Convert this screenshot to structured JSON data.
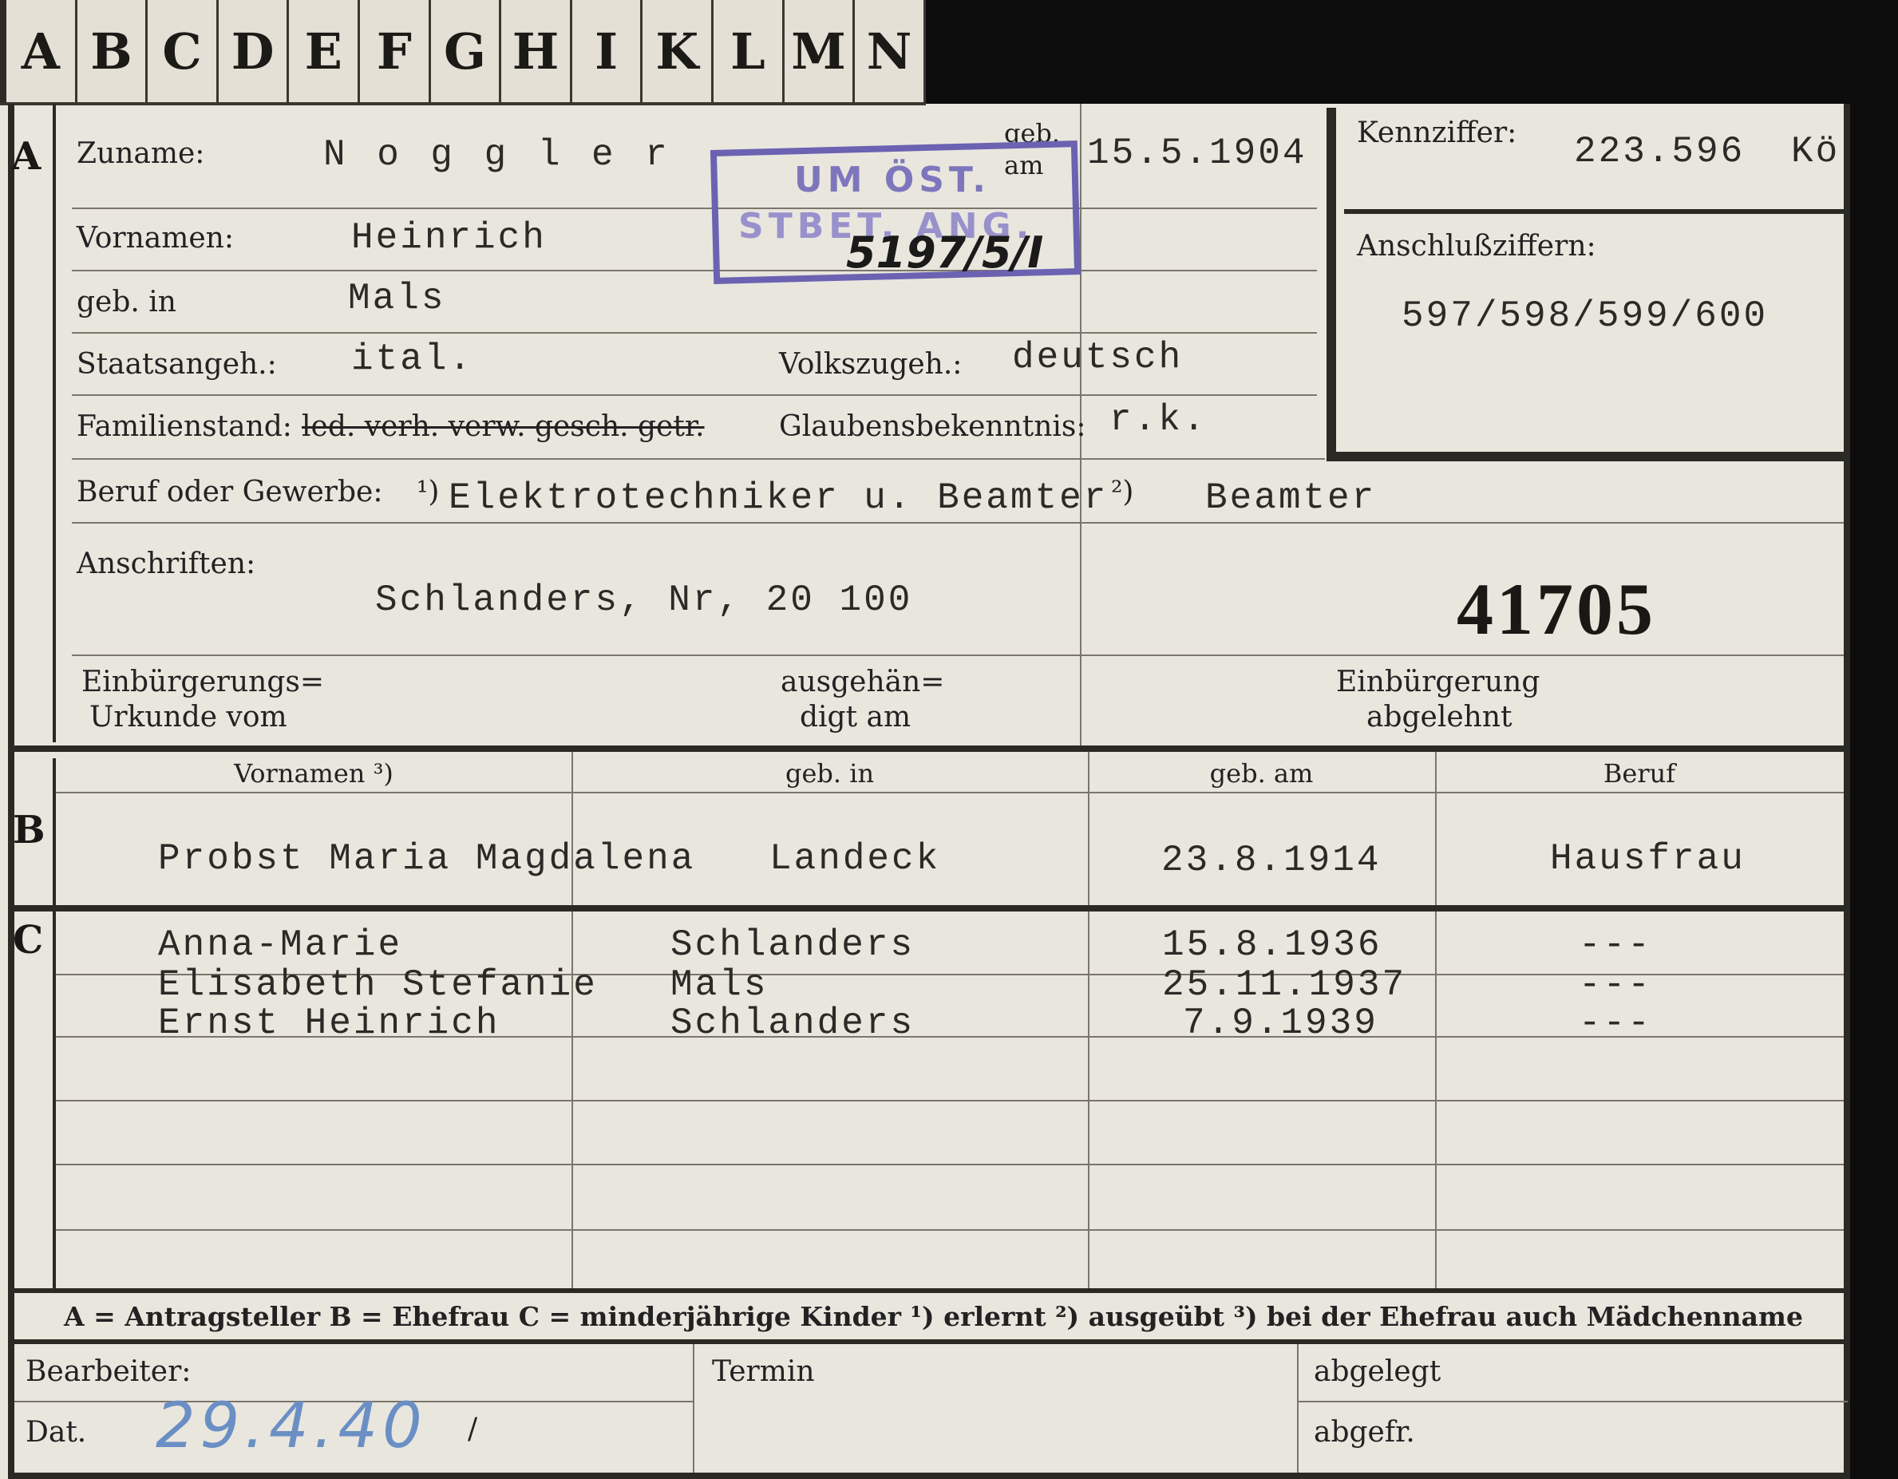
{
  "tabs": [
    "A",
    "B",
    "C",
    "D",
    "E",
    "F",
    "G",
    "H",
    "I",
    "K",
    "L",
    "M",
    "N"
  ],
  "sections": {
    "a": "A",
    "b": "B",
    "c": "C"
  },
  "person": {
    "surname_label": "Zuname:",
    "surname": "N o g g l e r",
    "firstname_label": "Vornamen:",
    "firstname": "Heinrich",
    "birthplace_label": "geb. in",
    "birthplace": "Mals",
    "birthdate_label_1": "geb.",
    "birthdate_label_2": "am",
    "birthdate": "15.5.1904",
    "nationality_label": "Staatsangeh.:",
    "nationality": "ital.",
    "ethnicity_label": "Volkszugeh.:",
    "ethnicity": "deutsch",
    "marital_label": "Familienstand:",
    "marital_options": "led. verh. verw. gesch. getr.",
    "religion_label": "Glaubensbekenntnis:",
    "religion": "r.k.",
    "profession_label": "Beruf oder Gewerbe:",
    "profession_marker_1": "¹)",
    "profession_learned": "Elektrotechniker u. Beamter",
    "profession_marker_2": "²)",
    "profession_practiced": "Beamter",
    "address_label": "Anschriften:",
    "address": "Schlanders, Nr, 20 100",
    "file_number": "41705",
    "naturalization_cert_label_1": "Einbürgerungs=",
    "naturalization_cert_label_2": "Urkunde vom",
    "handed_label_1": "ausgehän=",
    "handed_label_2": "digt am",
    "refused_label_1": "Einbürgerung",
    "refused_label_2": "abgelehnt"
  },
  "stamp": {
    "line1": "UM ÖST.",
    "line2": "STBET. ANG.",
    "handwritten": "5197/5/I"
  },
  "right_box": {
    "code_label": "Kennziffer:",
    "code": "223.596",
    "code_suffix": "Kö",
    "linked_label": "Anschlußziffern:",
    "linked": "597/598/599/600"
  },
  "spouse_table": {
    "headers": [
      "Vornamen ³)",
      "geb. in",
      "geb. am",
      "Beruf"
    ],
    "row": [
      "Probst Maria Magdalena",
      "Landeck",
      "23.8.1914",
      "Hausfrau"
    ]
  },
  "children": [
    {
      "name": "Anna-Marie",
      "place": "Schlanders",
      "date": "15.8.1936",
      "job": "---"
    },
    {
      "name": "Elisabeth Stefanie",
      "place": "Mals",
      "date": "25.11.1937",
      "job": "---"
    },
    {
      "name": "Ernst Heinrich",
      "place": "Schlanders",
      "date": "7.9.1939",
      "job": "---"
    }
  ],
  "legend": "A = Antragsteller   B = Ehefrau   C = minderjährige Kinder   ¹) erlernt   ²) ausgeübt   ³) bei der Ehefrau auch Mädchenname",
  "footer": {
    "clerk_label": "Bearbeiter:",
    "date_label": "Dat.",
    "date_value": "29.4.40",
    "date_slash": "/",
    "deadline_label": "Termin",
    "filed_label": "abgelegt",
    "sent_label": "abgefr."
  },
  "colors": {
    "paper": "#e9e6de",
    "stamp": "#6b62b2",
    "ink": "#2c2a26",
    "pencil": "#6a8fc4"
  }
}
